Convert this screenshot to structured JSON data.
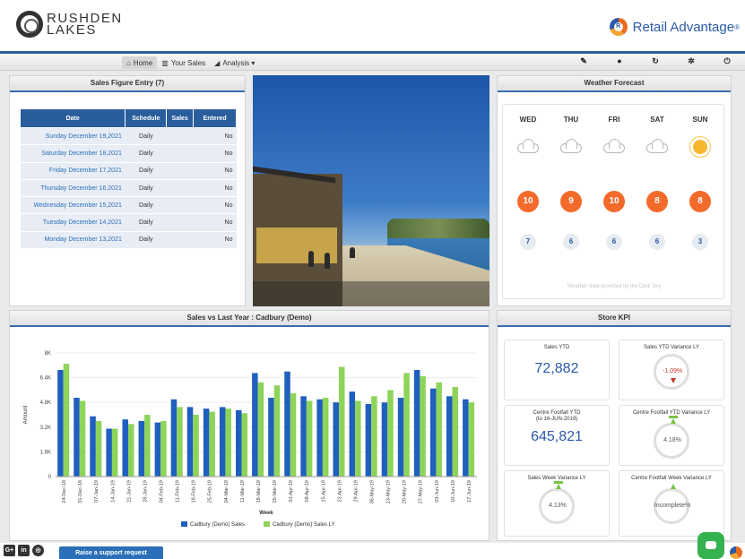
{
  "header": {
    "logo_line1": "RUSHDEN",
    "logo_line2": "LAKES",
    "brand": "Retail Advantage",
    "brand_reg": "®"
  },
  "nav": {
    "links": [
      {
        "label": "Home",
        "icon": "home-icon"
      },
      {
        "label": "Your Sales",
        "icon": "bar-chart-icon"
      },
      {
        "label": "Analysis ▾",
        "icon": "chart-icon"
      }
    ],
    "tools": [
      "wrench-icon",
      "help-icon",
      "refresh-icon",
      "gear-icon",
      "power-icon"
    ]
  },
  "sales_entry": {
    "title": "Sales Figure Entry (7)",
    "columns": [
      "Date",
      "Schedule",
      "Sales",
      "Entered"
    ],
    "rows": [
      {
        "date": "Sunday December 19,2021",
        "schedule": "Daily",
        "sales": "",
        "entered": "No"
      },
      {
        "date": "Saturday December 18,2021",
        "schedule": "Daily",
        "sales": "",
        "entered": "No"
      },
      {
        "date": "Friday December 17,2021",
        "schedule": "Daily",
        "sales": "",
        "entered": "No"
      },
      {
        "date": "Thursday December 16,2021",
        "schedule": "Daily",
        "sales": "",
        "entered": "No"
      },
      {
        "date": "Wednesday December 15,2021",
        "schedule": "Daily",
        "sales": "",
        "entered": "No"
      },
      {
        "date": "Tuesday December 14,2021",
        "schedule": "Daily",
        "sales": "",
        "entered": "No"
      },
      {
        "date": "Monday December 13,2021",
        "schedule": "Daily",
        "sales": "",
        "entered": "No"
      }
    ]
  },
  "weather": {
    "title": "Weather Forecast",
    "days": [
      {
        "day": "WED",
        "icon": "cloud-icon",
        "high": "10",
        "low": "7"
      },
      {
        "day": "THU",
        "icon": "cloud-icon",
        "high": "9",
        "low": "6"
      },
      {
        "day": "FRI",
        "icon": "cloud-icon",
        "high": "10",
        "low": "6"
      },
      {
        "day": "SAT",
        "icon": "cloud-icon",
        "high": "8",
        "low": "6"
      },
      {
        "day": "SUN",
        "icon": "sun-icon",
        "high": "8",
        "low": "3"
      }
    ],
    "credit": "Weather data provided by the Dark Sky"
  },
  "sales_chart": {
    "title": "Sales vs Last Year : Cadbury (Demo)"
  },
  "chart_data": {
    "type": "bar",
    "ylabel": "Amount",
    "xlabel": "Week",
    "ylim": [
      0,
      8000
    ],
    "yticks": [
      "0",
      "1.6K",
      "3.2K",
      "4.8K",
      "6.4K",
      "8K"
    ],
    "categories": [
      "24-Dec-18",
      "31-Dec-18",
      "07-Jan-19",
      "14-Jan-19",
      "21-Jan-19",
      "28-Jan-19",
      "04-Feb-19",
      "11-Feb-19",
      "18-Feb-19",
      "25-Feb-19",
      "04-Mar-19",
      "11-Mar-19",
      "18-Mar-19",
      "25-Mar-19",
      "01-Apr-19",
      "08-Apr-19",
      "15-Apr-19",
      "22-Apr-19",
      "29-Apr-19",
      "06-May-19",
      "13-May-19",
      "20-May-19",
      "27-May-19",
      "03-Jun-19",
      "10-Jun-19",
      "17-Jun-19"
    ],
    "series": [
      {
        "name": "Cadbury (Demo) Sales",
        "color": "#1f5fbd",
        "values": [
          6900,
          5100,
          3900,
          3100,
          3700,
          3600,
          3500,
          5000,
          4500,
          4400,
          4500,
          4300,
          6700,
          5100,
          6800,
          5200,
          5000,
          4800,
          5500,
          4700,
          4800,
          5100,
          6900,
          5700,
          5200,
          5000
        ]
      },
      {
        "name": "Cadbury (Demo) Sales LY",
        "color": "#8ed45a",
        "values": [
          7300,
          4900,
          3600,
          3100,
          3400,
          4000,
          3600,
          4500,
          4000,
          4200,
          4400,
          4100,
          6100,
          5900,
          5400,
          4900,
          5100,
          7100,
          4900,
          5200,
          5600,
          6700,
          6500,
          6100,
          5800,
          4800
        ]
      }
    ],
    "legend": "bottom"
  },
  "kpi": {
    "title": "Store KPI",
    "sales_ytd_label": "Sales YTD",
    "sales_ytd_value": "72,882",
    "sales_ytd_var_label": "Sales YTD Variance LY",
    "sales_ytd_var_value": "-1.09%",
    "footfall_ytd_label": "Centre Footfall YTD",
    "footfall_ytd_sub": "(to 16-JUN-2019)",
    "footfall_ytd_value": "645,821",
    "footfall_ytd_var_label": "Centre Footfall YTD Variance LY",
    "footfall_ytd_var_value": "4.18%",
    "sales_week_var_label": "Sales Week Variance LY",
    "sales_week_var_value": "4.13%",
    "footfall_week_var_label": "Centre Footfall Week Variance LY",
    "footfall_week_var_value": "Incomplete%"
  },
  "footer": {
    "support_button": "Raise a support request",
    "social": [
      "G+",
      "in",
      "gh"
    ]
  }
}
